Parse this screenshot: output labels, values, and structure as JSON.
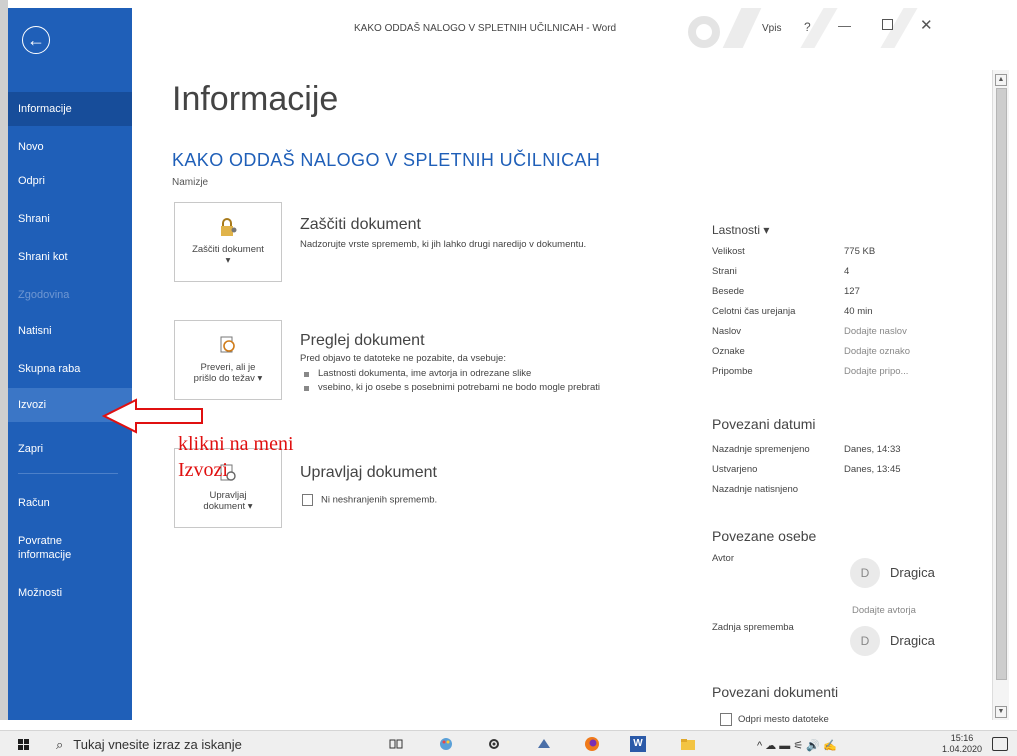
{
  "window": {
    "title": "KAKO ODDAŠ NALOGO V SPLETNIH UČILNICAH  -  Word",
    "signin": "Vpis",
    "help": "?",
    "min": "—",
    "close": "✕"
  },
  "sidebar": {
    "back_symbol": "←",
    "items": [
      {
        "label": "Informacije"
      },
      {
        "label": "Novo"
      },
      {
        "label": "Odpri"
      },
      {
        "label": "Shrani"
      },
      {
        "label": "Shrani kot"
      },
      {
        "label": "Zgodovina"
      },
      {
        "label": "Natisni"
      },
      {
        "label": "Skupna raba"
      },
      {
        "label": "Izvozi"
      },
      {
        "label": "Zapri"
      },
      {
        "label": "Račun"
      },
      {
        "label": "Povratne informacije"
      },
      {
        "label": "Možnosti"
      }
    ]
  },
  "main": {
    "page_title": "Informacije",
    "doc_title": "KAKO ODDAŠ NALOGO V SPLETNIH UČILNICAH",
    "location": "Namizje",
    "protect": {
      "tile_label": "Zaščiti dokument ▾",
      "heading": "Zaščiti dokument",
      "desc": "Nadzorujte vrste sprememb, ki jih lahko drugi naredijo v dokumentu."
    },
    "inspect": {
      "tile_label": "Preveri, ali je prišlo do težav ▾",
      "heading": "Preglej dokument",
      "desc": "Pred objavo te datoteke ne pozabite, da vsebuje:",
      "bullets": [
        "Lastnosti dokumenta, ime avtorja in odrezane slike",
        "vsebino, ki jo osebe s posebnimi potrebami ne bodo mogle prebrati"
      ]
    },
    "manage": {
      "tile_label": "Upravljaj dokument ▾",
      "heading": "Upravljaj dokument",
      "desc": "Ni neshranjenih sprememb."
    }
  },
  "properties": {
    "heading": "Lastnosti ▾",
    "rows": [
      {
        "k": "Velikost",
        "v": "775 KB"
      },
      {
        "k": "Strani",
        "v": "4"
      },
      {
        "k": "Besede",
        "v": "127"
      },
      {
        "k": "Celotni čas urejanja",
        "v": "40 min"
      },
      {
        "k": "Naslov",
        "v": "Dodajte naslov"
      },
      {
        "k": "Oznake",
        "v": "Dodajte oznako"
      },
      {
        "k": "Pripombe",
        "v": "Dodajte pripo..."
      }
    ],
    "dates_heading": "Povezani datumi",
    "dates": [
      {
        "k": "Nazadnje spremenjeno",
        "v": "Danes, 14:33"
      },
      {
        "k": "Ustvarjeno",
        "v": "Danes, 13:45"
      },
      {
        "k": "Nazadnje natisnjeno",
        "v": ""
      }
    ],
    "people_heading": "Povezane osebe",
    "author_label": "Avtor",
    "author_initial": "D",
    "author_name": "Dragica",
    "add_author": "Dodajte avtorja",
    "last_modified_by_label": "Zadnja sprememba",
    "last_modified_initial": "D",
    "last_modified_name": "Dragica",
    "related_docs_heading": "Povezani dokumenti",
    "open_location": "Odpri mesto datoteke"
  },
  "annotation": {
    "line1": "klikni na meni",
    "line2": "Izvozi",
    "color": "#e01010"
  },
  "taskbar": {
    "search_placeholder": "Tukaj vnesite izraz za iskanje",
    "time": "15:16",
    "date": "1.04.2020",
    "word_label": "W"
  },
  "colors": {
    "sidebar": "#1f5fb8",
    "accent": "#1f5fb8"
  }
}
